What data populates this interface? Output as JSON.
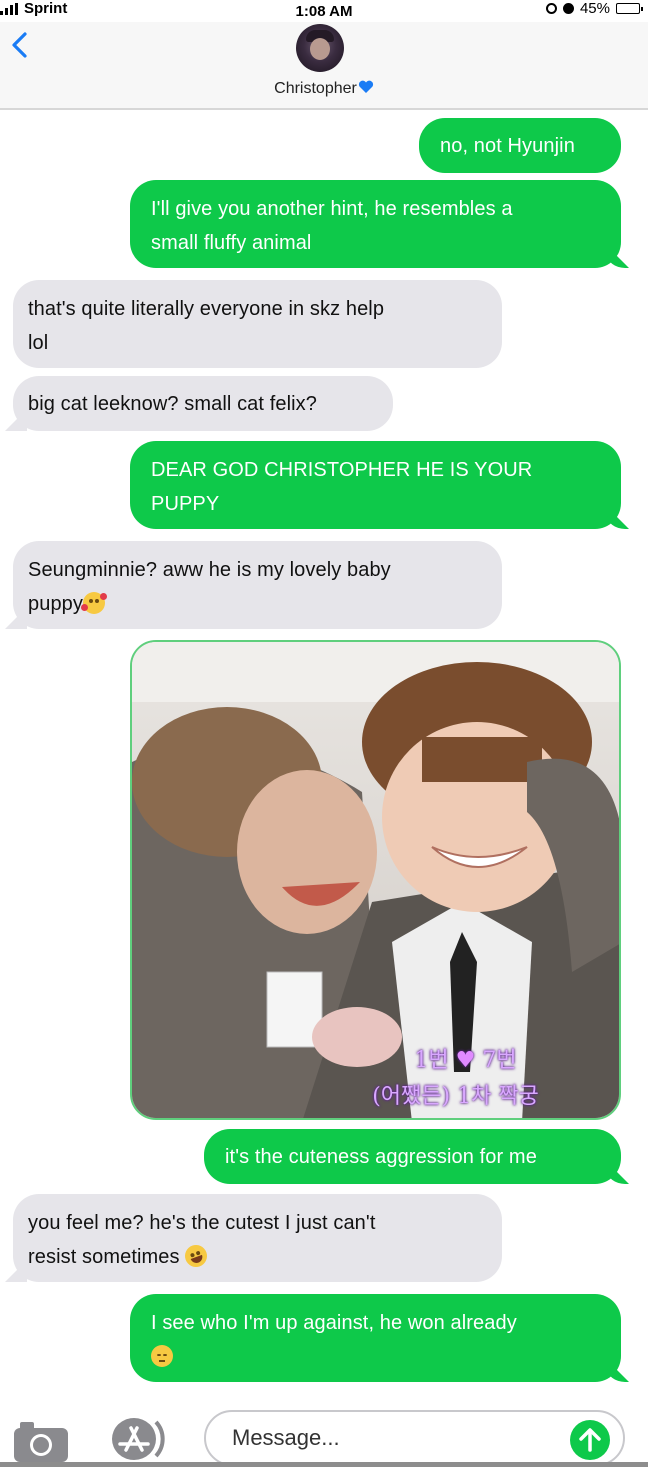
{
  "status_bar": {
    "carrier": "Sprint",
    "time": "1:08 AM",
    "battery": "45%",
    "battery_level": 0.45
  },
  "header": {
    "contact_name": "Christopher",
    "contact_emoji": "blue-heart-icon"
  },
  "messages": [
    {
      "type": "sent",
      "text": "no, not Hyunjin"
    },
    {
      "type": "sent",
      "line1": "I'll give you another hint, he resembles a",
      "line2": "small fluffy animal"
    },
    {
      "type": "received",
      "line1": "that's quite literally everyone in skz help",
      "line2": "lol"
    },
    {
      "type": "received",
      "text": "big cat leeknow? small cat felix?"
    },
    {
      "type": "sent",
      "line1": "DEAR GOD CHRISTOPHER HE IS YOUR",
      "line2": "PUPPY"
    },
    {
      "type": "received",
      "line1": "Seungminnie? aww he is my lovely baby",
      "line2": "puppy",
      "emoji": "smiling-face-with-hearts-icon"
    },
    {
      "type": "image",
      "caption_line1": "1번",
      "caption_heart": "♥",
      "caption_line1b": "7번",
      "caption_line2": "(어쨌든) 1차 짝궁"
    },
    {
      "type": "sent",
      "text": "it's the cuteness aggression for me"
    },
    {
      "type": "received",
      "line1": "you feel me? he's the cutest I just can't",
      "line2": "resist sometimes",
      "emoji": "rolling-laughing-icon"
    },
    {
      "type": "sent",
      "line1": "I see who I'm up against, he won already",
      "emoji": "pensive-face-icon"
    }
  ],
  "input_bar": {
    "placeholder": "Message...",
    "camera_icon": "camera-icon",
    "apps_icon": "app-store-icon",
    "send_icon": "arrow-up-icon"
  },
  "colors": {
    "sent_bubble": "#0ec94a",
    "received_bubble": "#e6e5ea",
    "back_arrow": "#1a7cf5",
    "heart": "#1a7cf5"
  }
}
